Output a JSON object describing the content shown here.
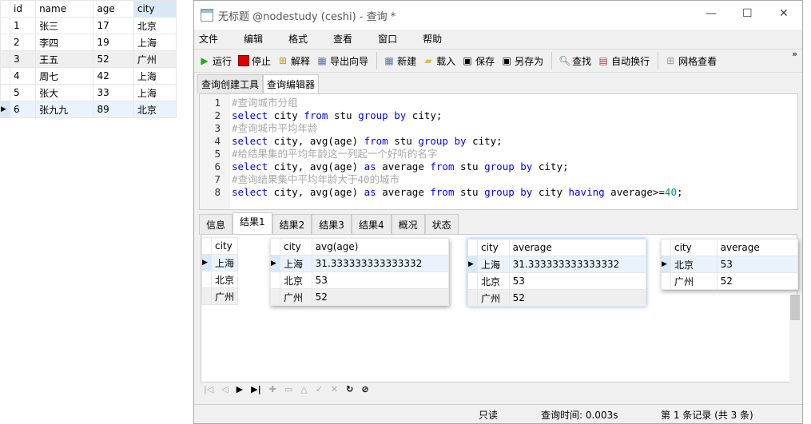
{
  "left_table": {
    "headers": [
      "id",
      "name",
      "age",
      "city"
    ],
    "rows": [
      [
        "1",
        "张三",
        "17",
        "北京"
      ],
      [
        "2",
        "李四",
        "19",
        "上海"
      ],
      [
        "3",
        "王五",
        "52",
        "广州"
      ],
      [
        "4",
        "周七",
        "42",
        "上海"
      ],
      [
        "5",
        "张大",
        "33",
        "上海"
      ],
      [
        "6",
        "张九九",
        "89",
        "北京"
      ]
    ]
  },
  "window": {
    "title": "无标题 @nodestudy (ceshi) - 查询 *"
  },
  "menu": [
    "文件",
    "编辑",
    "格式",
    "查看",
    "窗口",
    "帮助"
  ],
  "toolbar": {
    "run": "运行",
    "stop": "停止",
    "explain": "解释",
    "export": "导出向导",
    "new": "新建",
    "load": "载入",
    "save": "保存",
    "save_as": "另存为",
    "find": "查找",
    "wrap": "自动换行",
    "grid": "网格查看"
  },
  "query_tabs": [
    "查询创建工具",
    "查询编辑器"
  ],
  "editor": {
    "lines": [
      [
        [
          "cm",
          "#查询城市分组"
        ]
      ],
      [
        [
          "kw",
          "select"
        ],
        [
          "t",
          " city "
        ],
        [
          "kw",
          "from"
        ],
        [
          "t",
          " stu "
        ],
        [
          "kw",
          "group by"
        ],
        [
          "t",
          " city;"
        ]
      ],
      [
        [
          "cm",
          "#查询城市平均年龄"
        ]
      ],
      [
        [
          "kw",
          "select"
        ],
        [
          "t",
          " city, avg(age) "
        ],
        [
          "kw",
          "from"
        ],
        [
          "t",
          " stu "
        ],
        [
          "kw",
          "group by"
        ],
        [
          "t",
          " city;"
        ]
      ],
      [
        [
          "cm",
          "#给结果集的平均年龄这一列起一个好听的名字"
        ]
      ],
      [
        [
          "kw",
          "select"
        ],
        [
          "t",
          " city, avg(age) "
        ],
        [
          "kw",
          "as"
        ],
        [
          "t",
          " average "
        ],
        [
          "kw",
          "from"
        ],
        [
          "t",
          " stu "
        ],
        [
          "kw",
          "group by"
        ],
        [
          "t",
          " city;"
        ]
      ],
      [
        [
          "cm",
          "#查询结果集中平均年龄大于40的城市"
        ]
      ],
      [
        [
          "kw",
          "select"
        ],
        [
          "t",
          " city, avg(age) "
        ],
        [
          "kw",
          "as"
        ],
        [
          "t",
          " average "
        ],
        [
          "kw",
          "from"
        ],
        [
          "t",
          " stu "
        ],
        [
          "kw",
          "group by"
        ],
        [
          "t",
          " city "
        ],
        [
          "kw",
          "having"
        ],
        [
          "t",
          " average>="
        ],
        [
          "num",
          "40"
        ],
        [
          "t",
          ";"
        ]
      ]
    ]
  },
  "result_tabs": [
    "信息",
    "结果1",
    "结果2",
    "结果3",
    "结果4",
    "概况",
    "状态"
  ],
  "results": [
    {
      "headers": [
        "city"
      ],
      "rows": [
        [
          "上海"
        ],
        [
          "北京"
        ],
        [
          "广州"
        ]
      ]
    },
    {
      "headers": [
        "city",
        "avg(age)"
      ],
      "rows": [
        [
          "上海",
          "31.333333333333332"
        ],
        [
          "北京",
          "53"
        ],
        [
          "广州",
          "52"
        ]
      ]
    },
    {
      "headers": [
        "city",
        "average"
      ],
      "rows": [
        [
          "上海",
          "31.333333333333332"
        ],
        [
          "北京",
          "53"
        ],
        [
          "广州",
          "52"
        ]
      ]
    },
    {
      "headers": [
        "city",
        "average"
      ],
      "rows": [
        [
          "北京",
          "53"
        ],
        [
          "广州",
          "52"
        ]
      ]
    }
  ],
  "status": {
    "readonly": "只读",
    "query_time": "查询时间: 0.003s",
    "record": "第 1 条记录 (共 3 条)"
  }
}
